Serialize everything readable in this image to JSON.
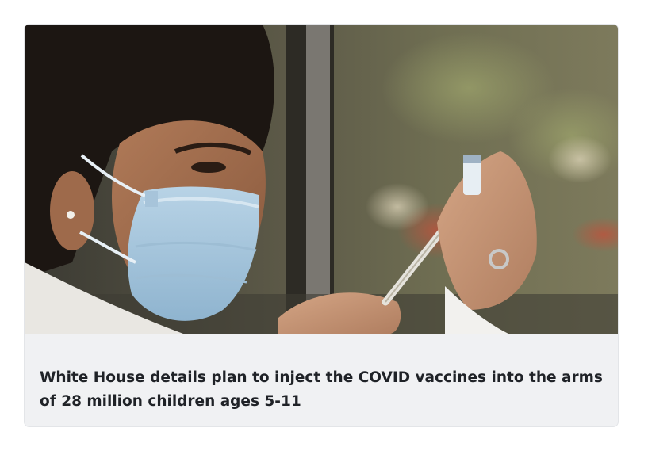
{
  "article": {
    "headline": "White House details plan to inject the COVID vaccines into the arms of 28 million children ages 5-11",
    "image_subject": "healthcare worker in surgical mask preparing vaccine syringe"
  }
}
